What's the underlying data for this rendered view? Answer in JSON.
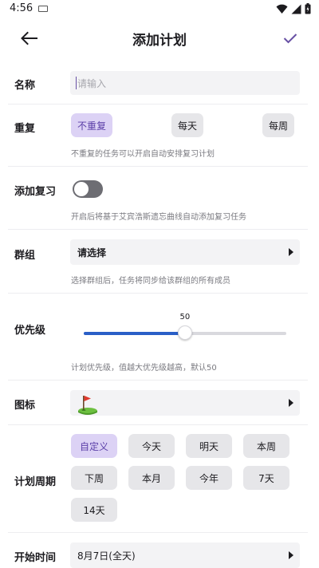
{
  "status_bar": {
    "time": "4:56"
  },
  "app_bar": {
    "title": "添加计划"
  },
  "form": {
    "name": {
      "label": "名称",
      "placeholder": "请输入"
    },
    "repeat": {
      "label": "重复",
      "options": [
        "不重复",
        "每天",
        "每周"
      ],
      "selected": "不重复",
      "hint": "不重复的任务可以开启自动安排复习计划"
    },
    "add_review": {
      "label": "添加复习",
      "enabled": false,
      "hint": "开启后将基于艾宾浩斯遗忘曲线自动添加复习任务"
    },
    "group": {
      "label": "群组",
      "value": "请选择",
      "hint": "选择群组后，任务将同步给该群组的所有成员"
    },
    "priority": {
      "label": "优先级",
      "value": 50,
      "min": 0,
      "max": 100,
      "value_text": "50",
      "hint": "计划优先级，值越大优先级越高，默认50"
    },
    "icon": {
      "label": "图标",
      "value_icon": "golf-flag-icon"
    },
    "period": {
      "label": "计划周期",
      "options": [
        "自定义",
        "今天",
        "明天",
        "本周",
        "下周",
        "本月",
        "今年",
        "7天",
        "14天"
      ],
      "selected": "自定义"
    },
    "start_time": {
      "label": "开始时间",
      "value": "8月7日(全天)"
    }
  },
  "colors": {
    "accent": "#6750a4",
    "chip_selected_bg": "#dcd2f5",
    "slider_active": "#2a5fc7",
    "page_bg": "#f8f6fb"
  }
}
